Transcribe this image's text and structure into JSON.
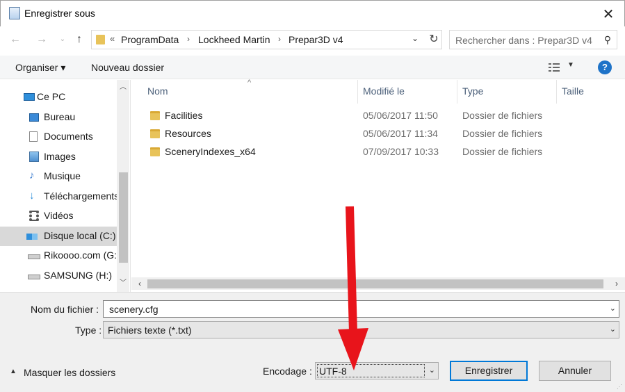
{
  "window": {
    "title": "Enregistrer sous",
    "close_glyph": "✕"
  },
  "nav": {
    "back_glyph": "←",
    "forward_glyph": "→",
    "recent_glyph": "⌄",
    "up_glyph": "↑"
  },
  "address": {
    "chevron": "«",
    "crumbs": [
      "ProgramData",
      "Lockheed Martin",
      "Prepar3D v4"
    ],
    "separator": "›",
    "dropdown_glyph": "⌄",
    "refresh_glyph": "↻"
  },
  "search": {
    "placeholder": "Rechercher dans : Prepar3D v4",
    "icon_glyph": "⚲"
  },
  "toolbar": {
    "organiser_label": "Organiser ▾",
    "nouveau_label": "Nouveau dossier",
    "view_drop_glyph": "▼",
    "help_glyph": "?"
  },
  "sidebar": {
    "root_label": "Ce PC",
    "items": [
      {
        "label": "Bureau",
        "icon": "desktop-icon",
        "color": "#3b8ad8"
      },
      {
        "label": "Documents",
        "icon": "documents-icon",
        "color": "#d9d9d9"
      },
      {
        "label": "Images",
        "icon": "pictures-icon",
        "color": "#6aa9dd"
      },
      {
        "label": "Musique",
        "icon": "music-icon",
        "color": "#3f7fd0"
      },
      {
        "label": "Téléchargements",
        "icon": "downloads-icon",
        "color": "#2f8fdb"
      },
      {
        "label": "Vidéos",
        "icon": "videos-icon",
        "color": "#555555"
      },
      {
        "label": "Disque local (C:)",
        "icon": "local-disk-icon",
        "color": "#2f8fdb",
        "selected": true
      },
      {
        "label": "Rikoooo.com (G:",
        "icon": "drive-icon",
        "color": "#9a9a9a"
      },
      {
        "label": "SAMSUNG (H:)",
        "icon": "drive-icon",
        "color": "#9a9a9a"
      }
    ],
    "scroll_up": "︿",
    "scroll_down": "﹀"
  },
  "filelist": {
    "sort_indicator": "^",
    "columns": [
      "Nom",
      "Modifié le",
      "Type",
      "Taille"
    ],
    "rows": [
      {
        "name": "Facilities",
        "date": "05/06/2017 11:50",
        "type": "Dossier de fichiers"
      },
      {
        "name": "Resources",
        "date": "05/06/2017 11:34",
        "type": "Dossier de fichiers"
      },
      {
        "name": "SceneryIndexes_x64",
        "date": "07/09/2017 10:33",
        "type": "Dossier de fichiers"
      }
    ],
    "hscroll_left": "‹",
    "hscroll_right": "›"
  },
  "form": {
    "filename_label": "Nom du fichier :",
    "filename_value": "scenery.cfg",
    "type_label": "Type :",
    "type_value": "Fichiers texte (*.txt)",
    "dropdown_glyph": "⌄",
    "toggle_folders_glyph": "▲",
    "toggle_folders_label": "Masquer les dossiers",
    "encodage_label": "Encodage :",
    "encodage_value": "UTF-8",
    "save_label": "Enregistrer",
    "cancel_label": "Annuler"
  },
  "colors": {
    "accent": "#0078d7",
    "annotation_arrow": "#e8141b",
    "folder": "#e8c35a"
  }
}
